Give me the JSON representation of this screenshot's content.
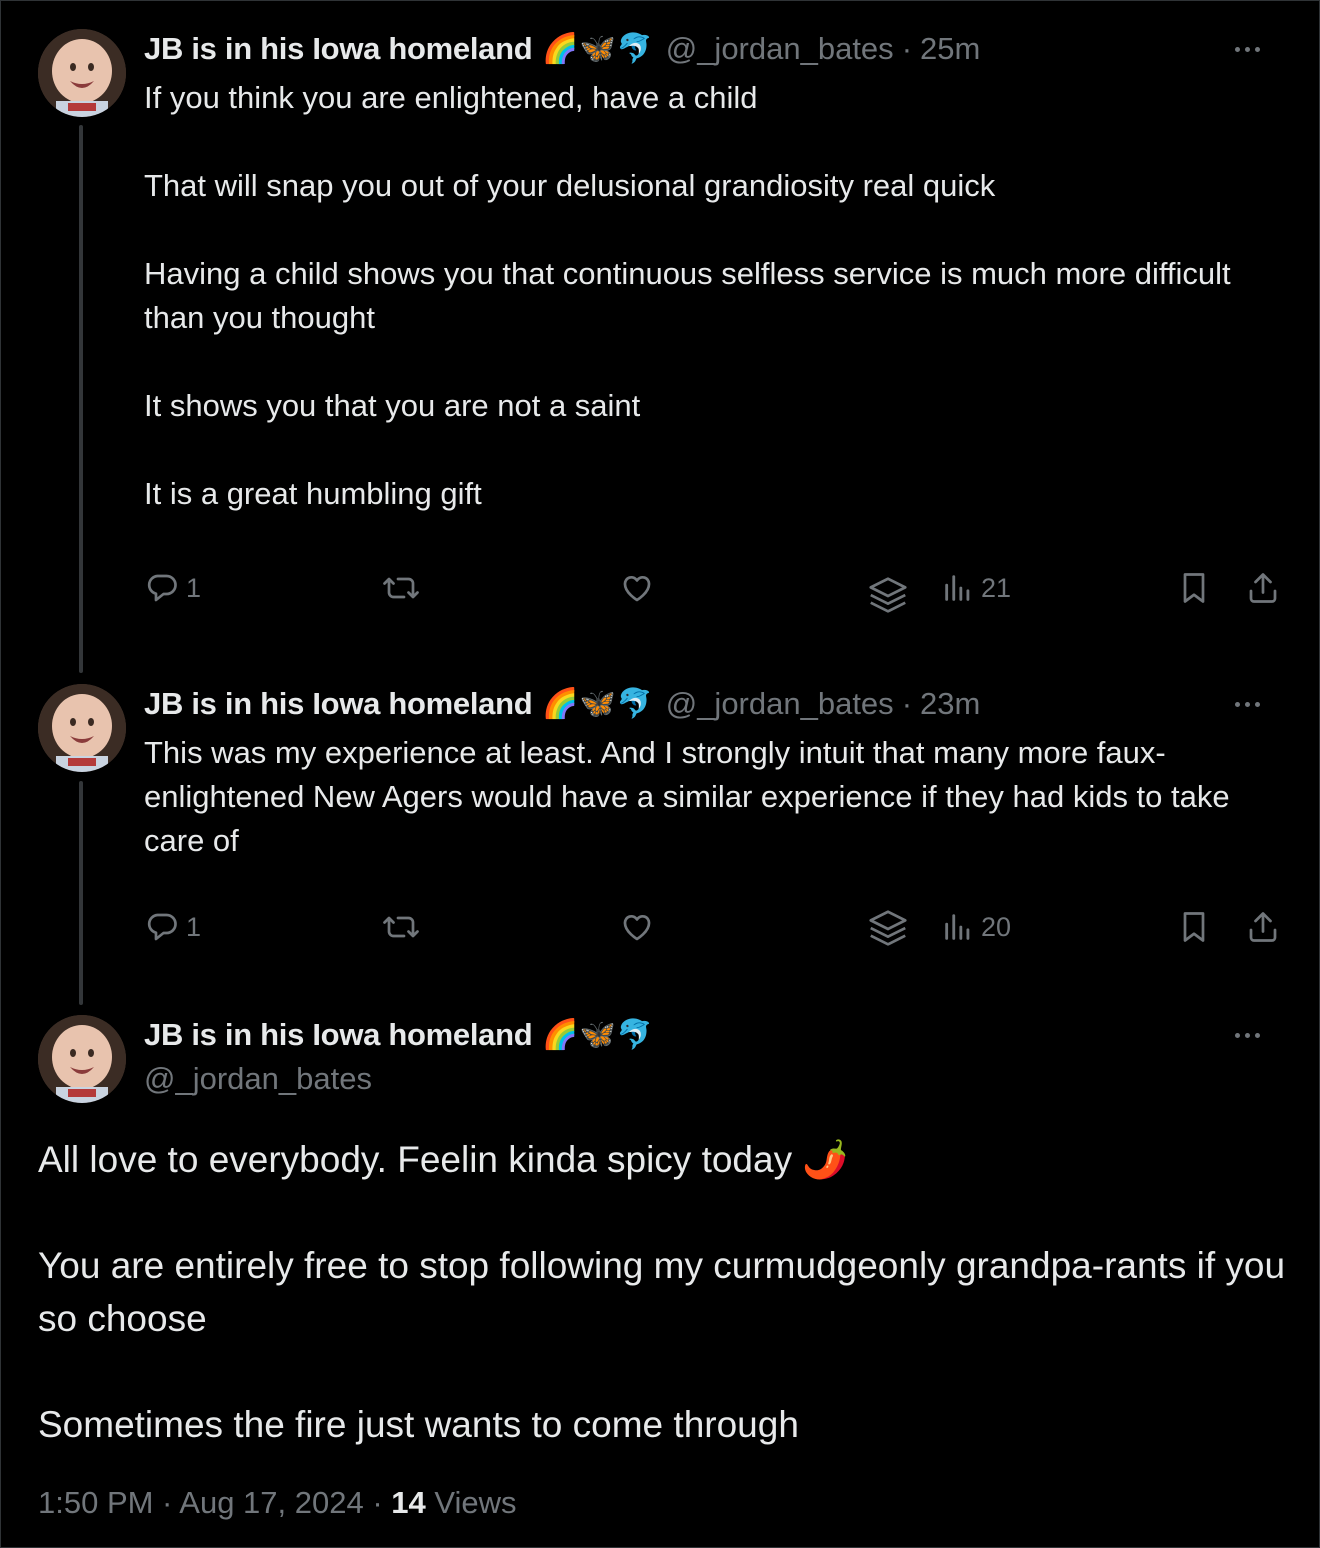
{
  "tweets": [
    {
      "display_name": "JB is in his Iowa homeland",
      "badges": "🌈🦋🐬",
      "handle": "@_jordan_bates",
      "separator": "·",
      "time": "25m",
      "paragraphs": [
        "If you think you are enlightened, have a child",
        "That will snap you out of your delusional grandiosity real quick",
        "Having a child shows you that continuous selfless service is much more difficult than you thought",
        "It shows you that you are not a saint",
        "It is a great humbling gift"
      ],
      "replies": "1",
      "views": "21"
    },
    {
      "display_name": "JB is in his Iowa homeland",
      "badges": "🌈🦋🐬",
      "handle": "@_jordan_bates",
      "separator": "·",
      "time": "23m",
      "paragraphs": [
        "This was my experience at least. And I strongly intuit that many more faux-enlightened New Agers would have a similar experience if they had kids to take care of"
      ],
      "replies": "1",
      "views": "20"
    }
  ],
  "main_tweet": {
    "display_name": "JB is in his Iowa homeland",
    "badges": "🌈🦋🐬",
    "handle": "@_jordan_bates",
    "paragraphs": [
      "All love to everybody. Feelin kinda spicy today 🌶️",
      "You are entirely free to stop following my curmudgeonly grandpa-rants if you so choose",
      "Sometimes the fire just wants to come through"
    ],
    "timestamp": "1:50 PM · Aug 17, 2024 ·",
    "views_count": "14",
    "views_label": "Views"
  },
  "icons": {
    "reply": "reply-icon",
    "retweet": "retweet-icon",
    "like": "heart-icon",
    "grok": "layers-icon",
    "views": "bar-chart-icon",
    "bookmark": "bookmark-icon",
    "share": "share-icon",
    "more": "more-dots-icon"
  },
  "colors": {
    "background": "#000000",
    "text": "#e7e9ea",
    "secondary": "#71767b",
    "thread_line": "#333639"
  }
}
